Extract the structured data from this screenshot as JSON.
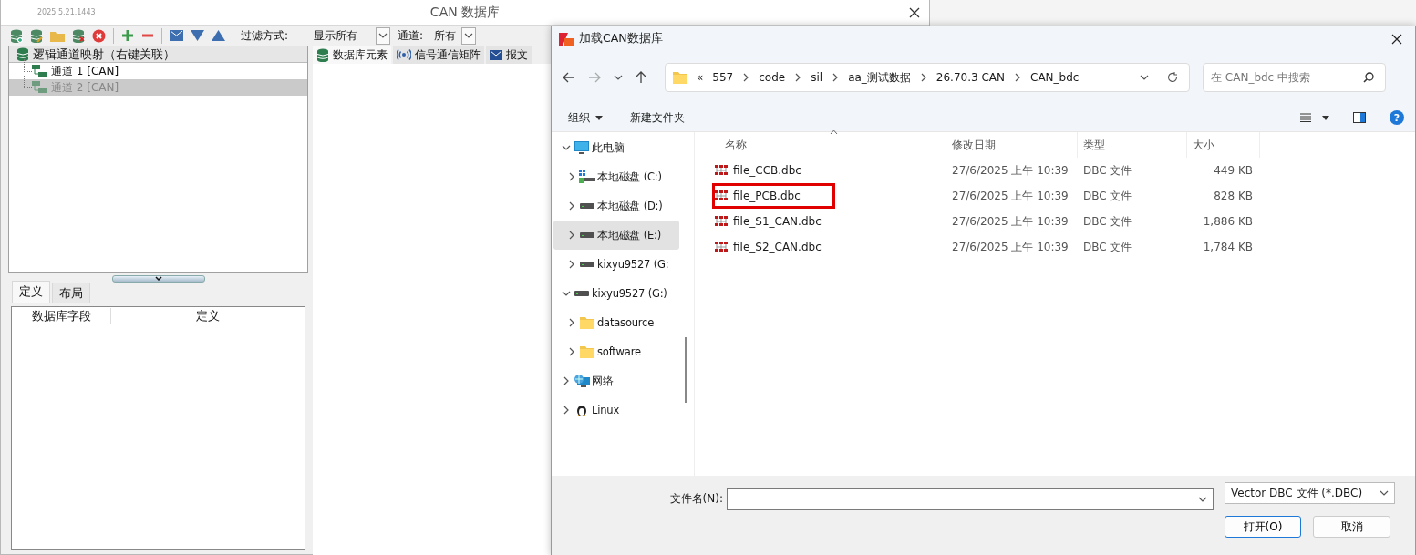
{
  "main_window": {
    "version": "2025.5.21.1443",
    "title": "CAN 数据库",
    "toolbar": {
      "filter_label": "过滤方式:",
      "filter_value": "显示所有",
      "channel_label": "通道:",
      "channel_value": "所有"
    },
    "mapping_tree": {
      "header": "逻辑通道映射（右键关联）",
      "items": [
        {
          "label": "通道 1 [CAN]",
          "selected": false
        },
        {
          "label": "通道 2 [CAN]",
          "selected": true
        }
      ]
    },
    "detail_tabs": [
      {
        "label": "定义",
        "selected": true
      },
      {
        "label": "布局",
        "selected": false
      }
    ],
    "definition_table": {
      "columns": [
        "数据库字段",
        "定义"
      ]
    },
    "view_tabs": [
      {
        "label": "数据库元素",
        "kind": "database",
        "selected": true
      },
      {
        "label": "信号通信矩阵",
        "kind": "signal",
        "selected": false
      },
      {
        "label": "报文",
        "kind": "message",
        "selected": false
      }
    ]
  },
  "dialog": {
    "title": "加载CAN数据库",
    "address": {
      "overflow": "«",
      "path": [
        "557",
        "code",
        "sil",
        "aa_测试数据",
        "26.70.3 CAN",
        "CAN_bdc"
      ]
    },
    "search": {
      "placeholder": "在 CAN_bdc 中搜索"
    },
    "commands": [
      {
        "label": "组织",
        "kind": "menu"
      },
      {
        "label": "新建文件夹",
        "kind": "button"
      }
    ],
    "help": "?",
    "navigation": [
      {
        "label": "此电脑",
        "kind": "computer",
        "expanded": true,
        "selected": false,
        "children": [
          {
            "label": "本地磁盘 (C:)",
            "kind": "system-drive",
            "expanded": false,
            "selected": false
          },
          {
            "label": "本地磁盘 (D:)",
            "kind": "drive",
            "expanded": false,
            "selected": false
          },
          {
            "label": "本地磁盘 (E:)",
            "kind": "drive",
            "expanded": false,
            "selected": true
          },
          {
            "label": "kixyu9527 (G:",
            "kind": "drive",
            "expanded": false,
            "selected": false
          }
        ]
      },
      {
        "label": "kixyu9527 (G:)",
        "kind": "drive",
        "expanded": true,
        "selected": false,
        "children": [
          {
            "label": "datasource",
            "kind": "folder",
            "expanded": false,
            "selected": false
          },
          {
            "label": "software",
            "kind": "folder",
            "expanded": false,
            "selected": false
          }
        ]
      },
      {
        "label": "网络",
        "kind": "network",
        "expanded": false,
        "selected": false
      },
      {
        "label": "Linux",
        "kind": "linux",
        "expanded": false,
        "selected": false
      }
    ],
    "file_list": {
      "columns": [
        "名称",
        "修改日期",
        "类型",
        "大小"
      ],
      "files": [
        {
          "name": "file_CCB.dbc",
          "modified": "27/6/2025 上午 10:39",
          "type": "DBC 文件",
          "size": "449 KB",
          "outlined": false
        },
        {
          "name": "file_PCB.dbc",
          "modified": "27/6/2025 上午 10:39",
          "type": "DBC 文件",
          "size": "828 KB",
          "outlined": true
        },
        {
          "name": "file_S1_CAN.dbc",
          "modified": "27/6/2025 上午 10:39",
          "type": "DBC 文件",
          "size": "1,886 KB",
          "outlined": false
        },
        {
          "name": "file_S2_CAN.dbc",
          "modified": "27/6/2025 上午 10:39",
          "type": "DBC 文件",
          "size": "1,784 KB",
          "outlined": false
        }
      ]
    },
    "filename_label": "文件名(N):",
    "file_type": "Vector DBC 文件 (*.DBC)",
    "buttons": [
      {
        "label": "打开(O)",
        "kind": "primary"
      },
      {
        "label": "取消",
        "kind": "secondary"
      }
    ]
  }
}
